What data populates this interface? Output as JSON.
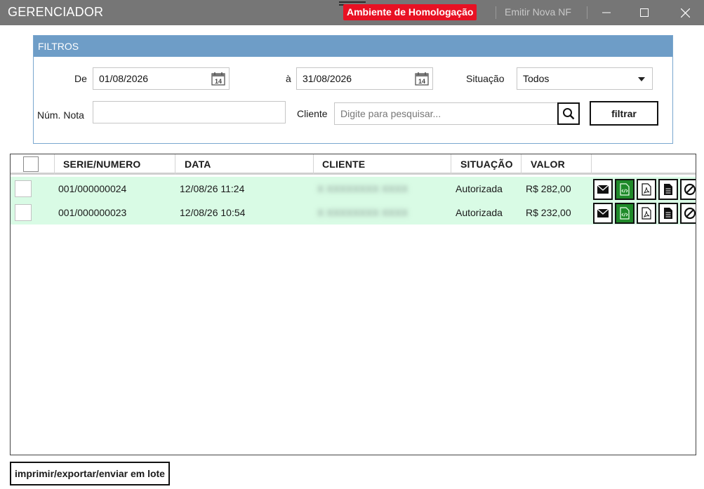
{
  "window": {
    "title": "GERENCIADOR",
    "environment_badge": "Ambiente de Homologação",
    "emit_link": "Emitir Nova NF"
  },
  "filters": {
    "header": "FILTROS",
    "de_label": "De",
    "de_value": "01/08/2026",
    "ate_label": "à",
    "ate_value": "31/08/2026",
    "situacao_label": "Situação",
    "situacao_value": "Todos",
    "num_nota_label": "Núm. Nota",
    "num_nota_value": "",
    "cliente_label": "Cliente",
    "cliente_placeholder": "Digite para pesquisar...",
    "filter_button": "filtrar"
  },
  "grid": {
    "columns": [
      "SERIE/NUMERO",
      "DATA",
      "CLIENTE",
      "SITUAÇÃO",
      "VALOR"
    ],
    "rows": [
      {
        "serie": "001/000000024",
        "data": "12/08/26 11:24",
        "cliente": "X XXXXXXXX XXXX",
        "situacao": "Autorizada",
        "valor": "R$ 282,00"
      },
      {
        "serie": "001/000000023",
        "data": "12/08/26 10:54",
        "cliente": "X XXXXXXXX XXXX",
        "situacao": "Autorizada",
        "valor": "R$ 232,00"
      }
    ],
    "row_actions": [
      "envelope-icon",
      "xml-file-icon",
      "pdf-file-icon",
      "document-icon",
      "cancel-icon"
    ]
  },
  "footer": {
    "bulk_button": "imprimir/exportar/enviar em lote"
  },
  "colors": {
    "titlebar": "#767676",
    "badge": "#e81123",
    "filters_header": "#6e9dc7",
    "row_bg": "#d9fbe5",
    "xml_button": "#1f8a2a"
  }
}
